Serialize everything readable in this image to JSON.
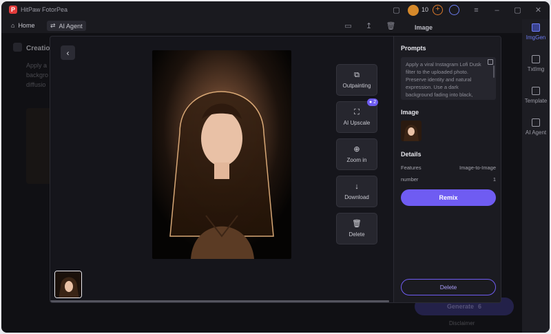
{
  "app": {
    "name": "HitPaw FotorPea",
    "credits": "10"
  },
  "nav": {
    "home": "Home",
    "ai_agent": "AI Agent"
  },
  "background": {
    "title": "Creatio",
    "text": "Apply a\nbackgro\ndiffusio",
    "panel_label": "Image",
    "generate": "Generate",
    "generate_cost": "6",
    "disclaimer": "Disclaimer"
  },
  "right_rail": [
    {
      "label": "ImgGen",
      "active": true
    },
    {
      "label": "TxtImg",
      "active": false
    },
    {
      "label": "Template",
      "active": false
    },
    {
      "label": "AI Agent",
      "active": false
    }
  ],
  "modal": {
    "tools": [
      {
        "label": "Outpainting",
        "icon": "outpainting-icon"
      },
      {
        "label": "AI Upscale",
        "icon": "upscale-icon"
      },
      {
        "label": "Zoom in",
        "icon": "zoom-in-icon"
      },
      {
        "label": "Download",
        "icon": "download-icon"
      },
      {
        "label": "Delete",
        "icon": "trash-icon"
      }
    ],
    "upscale_badge": "2",
    "panel": {
      "prompts_title": "Prompts",
      "prompt_text": "Apply a viral Instagram Lofi Dusk filter to the uploaded photo. Preserve identity and natural expression. Use a dark background fading into black, direct front flash lighting, powerful white backlight",
      "image_title": "Image",
      "details_title": "Details",
      "details": [
        {
          "key": "Features",
          "value": "Image-to-Image"
        },
        {
          "key": "number",
          "value": "1"
        }
      ],
      "remix": "Remix",
      "delete": "Delete"
    }
  },
  "colors": {
    "accent": "#6f5cf2",
    "background": "#15151b"
  }
}
